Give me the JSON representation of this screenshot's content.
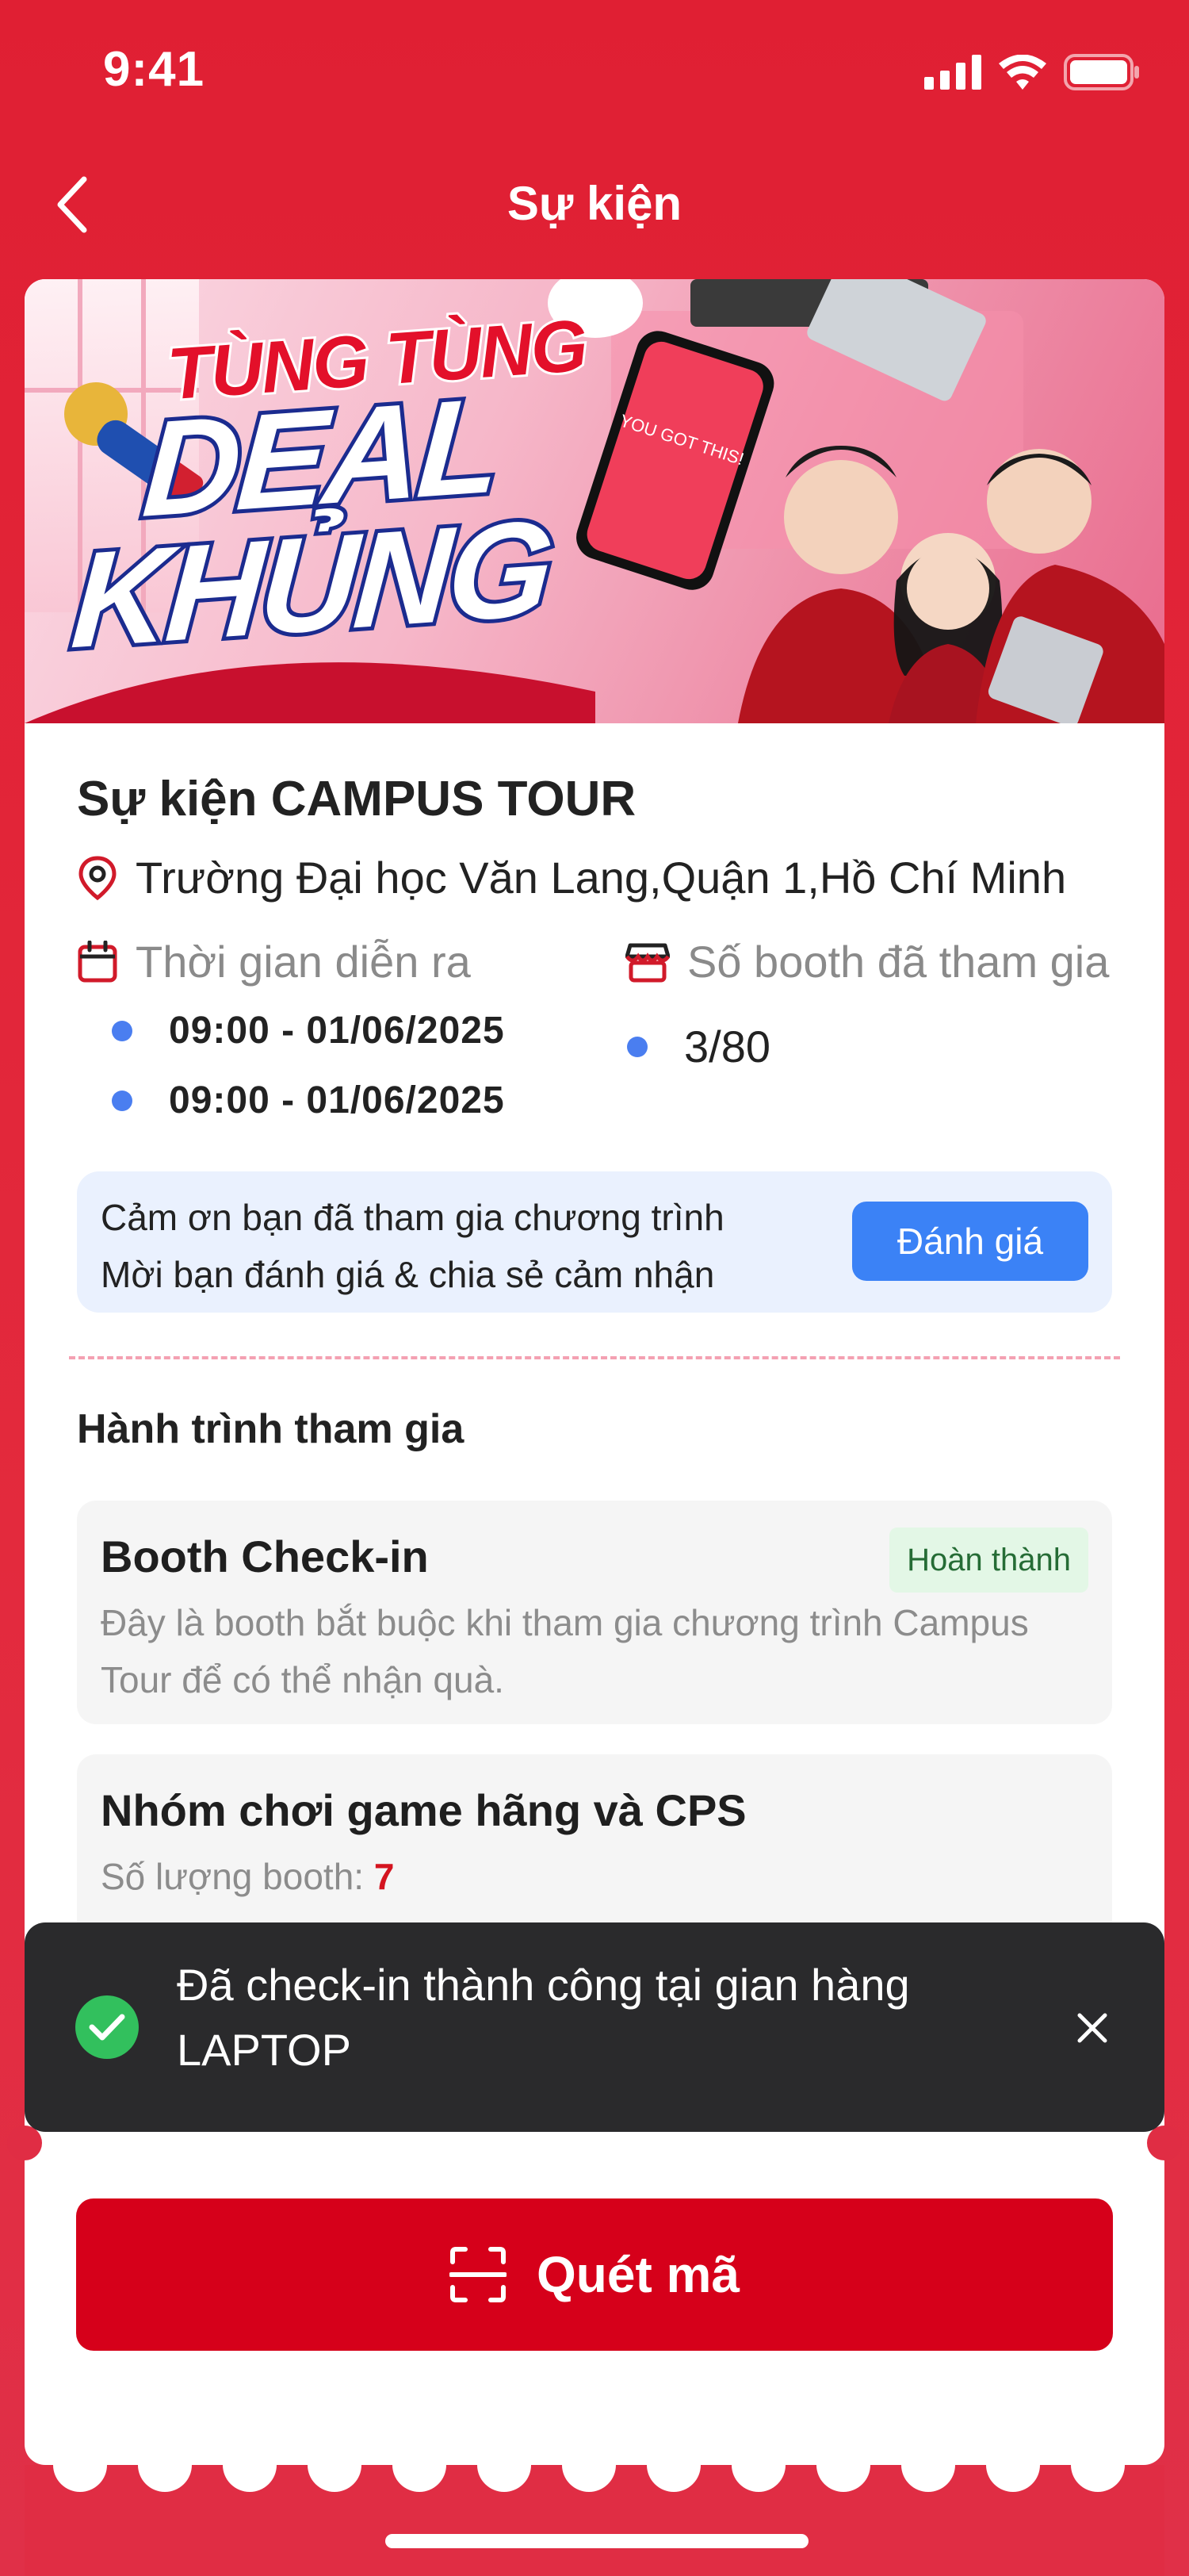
{
  "status_bar": {
    "time": "9:41"
  },
  "nav": {
    "title": "Sự kiện"
  },
  "banner": {
    "headline_top": "TÙNG TÙNG",
    "headline_1": "DEAL",
    "headline_2": "KHỦNG",
    "phone_text": "YOU GOT THIS!"
  },
  "event": {
    "title": "Sự kiện CAMPUS TOUR",
    "location": "Trường Đại học Văn Lang,Quận 1,Hồ Chí Minh",
    "time_label": "Thời gian diễn ra",
    "times": [
      "09:00 - 01/06/2025",
      "09:00 - 01/06/2025"
    ],
    "booth_label": "Số booth đã tham gia",
    "booth_value": "3/80"
  },
  "feedback": {
    "line1": "Cảm ơn bạn đã tham gia chương trình",
    "line2": "Mời bạn đánh giá & chia sẻ cảm nhận",
    "button": "Đánh giá"
  },
  "journey": {
    "title": "Hành trình tham gia",
    "items": [
      {
        "title": "Booth Check-in",
        "badge": "Hoàn thành",
        "desc": "Đây là booth bắt buộc khi tham gia chương trình Campus Tour để có thể nhận quà."
      },
      {
        "title": "Nhóm chơi game hãng và CPS",
        "count_label": "Số lượng booth:",
        "count": "7"
      }
    ]
  },
  "toast": {
    "message": "Đã check-in thành công tại gian hàng LAPTOP"
  },
  "scan_button": {
    "label": "Quét mã"
  },
  "colors": {
    "primary": "#e02436",
    "button": "#d6001a",
    "accent_blue": "#3b82f6",
    "success": "#32c05d"
  }
}
